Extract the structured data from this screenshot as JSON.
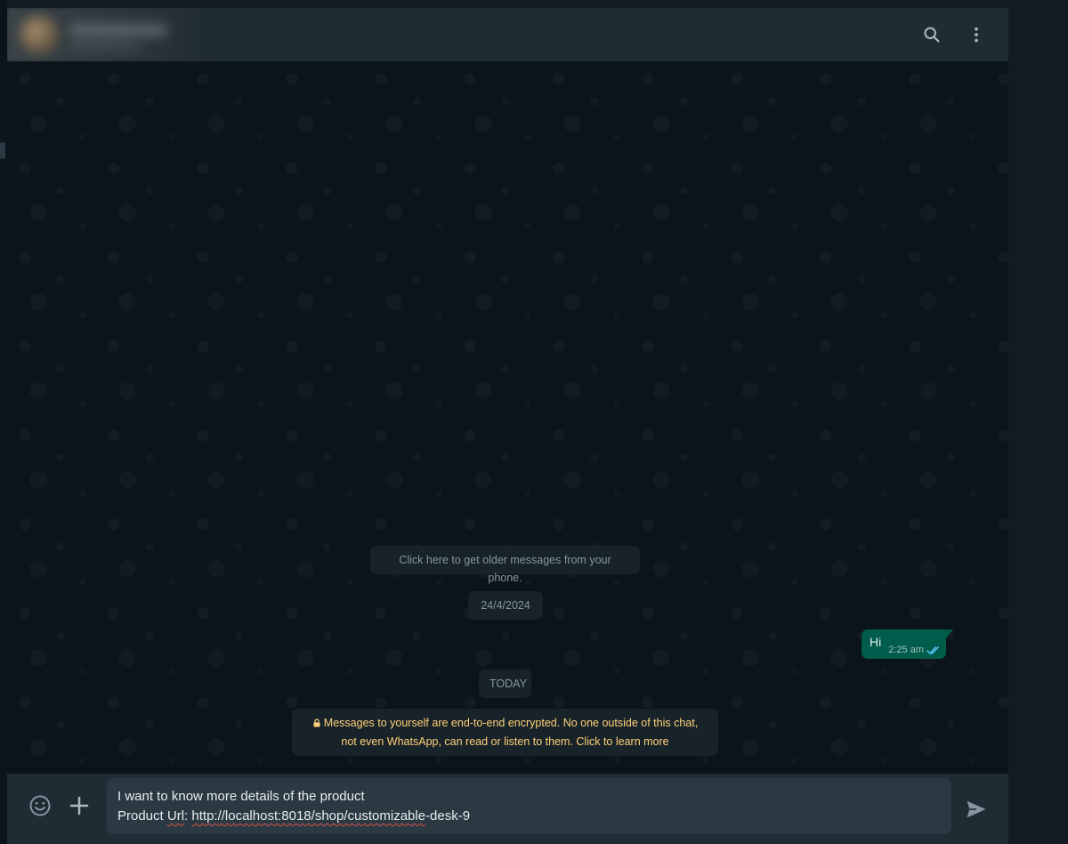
{
  "header": {
    "search_icon": "search-icon",
    "menu_icon": "more-vertical-icon"
  },
  "messages": {
    "older_notice": "Click here to get older messages from your phone.",
    "date_divider": "24/4/2024",
    "outgoing": {
      "text": "Hi",
      "time": "2:25 am",
      "status_icon": "double-check-icon"
    },
    "today_divider": "TODAY",
    "encryption_notice_line1": "Messages to yourself are end-to-end encrypted. No one outside of this chat,",
    "encryption_notice_line2": "not even WhatsApp, can read or listen to them. Click to learn more"
  },
  "composer": {
    "line1": "I want to know more details of the product",
    "line2_prefix": "Product ",
    "line2_word1": "Url",
    "line2_mid": ": ",
    "line2_url1": "http://localhost:8018/shop/",
    "line2_word2": "customizable",
    "line2_suffix": "-desk-9",
    "emoji_icon": "emoji-icon",
    "attach_icon": "plus-icon",
    "send_icon": "send-icon"
  },
  "colors": {
    "background": "#0b141a",
    "header": "#202c33",
    "outgoing_bubble": "#005c4b",
    "system_text": "#8696a0",
    "encryption_text": "#ffd279",
    "read_receipt": "#53bdeb"
  }
}
